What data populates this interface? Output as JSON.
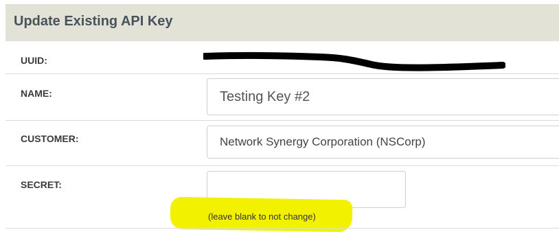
{
  "header": {
    "title": "Update Existing API Key"
  },
  "fields": {
    "uuid": {
      "label": "UUID:",
      "value": "",
      "redacted": true
    },
    "name": {
      "label": "NAME:",
      "value": "Testing Key #2"
    },
    "customer": {
      "label": "CUSTOMER:",
      "selected": "Network Synergy Corporation (NSCorp)"
    },
    "secret": {
      "label": "SECRET:",
      "value": "",
      "help": "(leave blank to not change)"
    }
  },
  "colors": {
    "header_background": "#e3e2d7",
    "title_text": "#47525c",
    "highlight": "#f2f200",
    "redaction": "#000000"
  }
}
